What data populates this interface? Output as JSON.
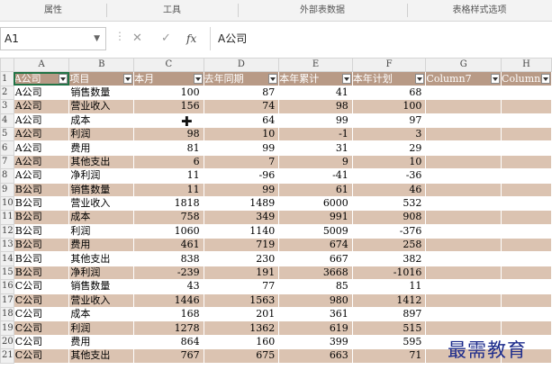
{
  "ribbon": {
    "groups": [
      "属性",
      "工具",
      "外部表数据",
      "表格样式选项"
    ]
  },
  "formula_bar": {
    "name_box": "A1",
    "formula": "A公司",
    "fx_label": "fx"
  },
  "columns": [
    "A",
    "B",
    "C",
    "D",
    "E",
    "F",
    "G",
    "H"
  ],
  "table": {
    "headers": [
      "A公司",
      "项目",
      "本月",
      "去年同期",
      "本年累计",
      "本年计划",
      "Column7",
      "Column"
    ],
    "rows": [
      [
        "A公司",
        "销售数量",
        "100",
        "87",
        "41",
        "68"
      ],
      [
        "A公司",
        "营业收入",
        "156",
        "74",
        "98",
        "100"
      ],
      [
        "A公司",
        "成本",
        "",
        "64",
        "99",
        "97"
      ],
      [
        "A公司",
        "利润",
        "98",
        "10",
        "-1",
        "3"
      ],
      [
        "A公司",
        "费用",
        "81",
        "99",
        "31",
        "29"
      ],
      [
        "A公司",
        "其他支出",
        "6",
        "7",
        "9",
        "10"
      ],
      [
        "A公司",
        "净利润",
        "11",
        "-96",
        "-41",
        "-36"
      ],
      [
        "B公司",
        "销售数量",
        "11",
        "99",
        "61",
        "46"
      ],
      [
        "B公司",
        "营业收入",
        "1818",
        "1489",
        "6000",
        "532"
      ],
      [
        "B公司",
        "成本",
        "758",
        "349",
        "991",
        "908"
      ],
      [
        "B公司",
        "利润",
        "1060",
        "1140",
        "5009",
        "-376"
      ],
      [
        "B公司",
        "费用",
        "461",
        "719",
        "674",
        "258"
      ],
      [
        "B公司",
        "其他支出",
        "838",
        "230",
        "667",
        "382"
      ],
      [
        "B公司",
        "净利润",
        "-239",
        "191",
        "3668",
        "-1016"
      ],
      [
        "C公司",
        "销售数量",
        "43",
        "77",
        "85",
        "11"
      ],
      [
        "C公司",
        "营业收入",
        "1446",
        "1563",
        "980",
        "1412"
      ],
      [
        "C公司",
        "成本",
        "168",
        "201",
        "361",
        "897"
      ],
      [
        "C公司",
        "利润",
        "1278",
        "1362",
        "619",
        "515"
      ],
      [
        "C公司",
        "费用",
        "864",
        "160",
        "399",
        "595"
      ],
      [
        "C公司",
        "其他支出",
        "767",
        "675",
        "663",
        "71"
      ]
    ]
  },
  "watermark": "最需教育",
  "colors": {
    "header_fill": "#b89a86",
    "band_fill": "#dbc3b1",
    "watermark": "#1d2c8c"
  }
}
